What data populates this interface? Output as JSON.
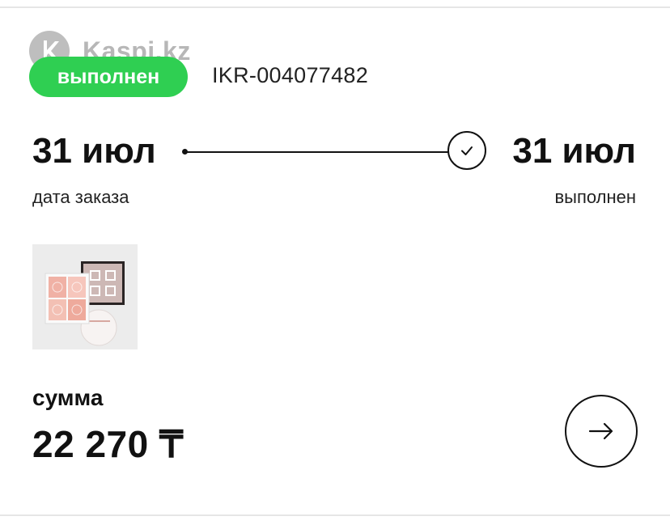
{
  "watermark": {
    "text": "Kaspi.kz"
  },
  "order": {
    "status": "выполнен",
    "id": "IKR-004077482"
  },
  "timeline": {
    "order_date": "31 июл",
    "order_date_label": "дата заказа",
    "completed_date": "31 июл",
    "completed_label": "выполнен"
  },
  "summary": {
    "label": "сумма",
    "amount": "22 270 ₸"
  },
  "colors": {
    "status_green": "#2fcf52",
    "text": "#111111"
  },
  "icons": {
    "status_step": "check-icon",
    "details": "arrow-right-icon"
  }
}
